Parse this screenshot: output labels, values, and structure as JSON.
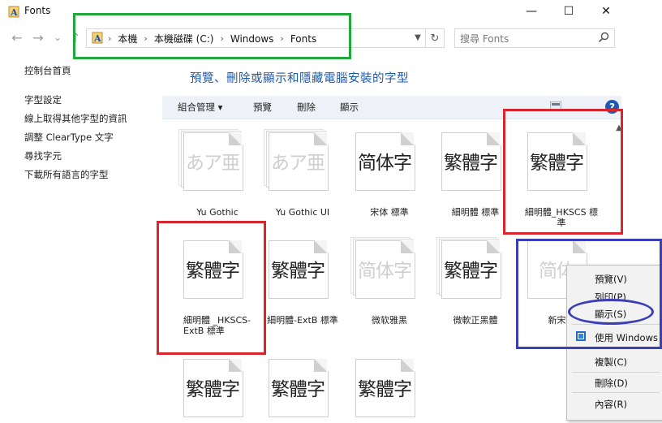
{
  "window": {
    "title": "Fonts"
  },
  "nav": {
    "back_symbol": "←",
    "forward_symbol": "→",
    "history_symbol": "⌄",
    "up_symbol": "↑",
    "breadcrumbs": [
      "本機",
      "本機磁碟 (C:)",
      "Windows",
      "Fonts"
    ],
    "crumb_separator": "›",
    "search_placeholder": "搜尋 Fonts"
  },
  "left_pane": {
    "links": [
      "控制台首頁",
      "字型設定",
      "線上取得其他字型的資訊",
      "調整 ClearType 文字",
      "尋找字元",
      "下載所有語言的字型"
    ]
  },
  "content": {
    "title": "預覽、刪除或顯示和隱藏電腦安裝的字型",
    "toolbar": {
      "organize": "組合管理 ▾",
      "preview": "預覽",
      "delete": "刪除",
      "show": "顯示"
    }
  },
  "fonts": [
    {
      "name": "Yu Gothic",
      "sample": "あア亜",
      "faint": true,
      "stack": true
    },
    {
      "name": "Yu Gothic UI",
      "sample": "あア亜",
      "faint": true,
      "stack": true
    },
    {
      "name": "宋体 標準",
      "sample": "简体字",
      "faint": false,
      "stack": false
    },
    {
      "name": "細明體 標準",
      "sample": "繁體字",
      "faint": false,
      "stack": false
    },
    {
      "name": "細明體_HKSCS 標準",
      "sample": "繁體字",
      "faint": false,
      "stack": false
    },
    {
      "name": "細明體 _HKSCS-ExtB 標準",
      "sample": "繁體字",
      "faint": false,
      "stack": false
    },
    {
      "name": "細明體-ExtB 標準",
      "sample": "繁體字",
      "faint": false,
      "stack": false
    },
    {
      "name": "微软雅黑",
      "sample": "简体字",
      "faint": true,
      "stack": true
    },
    {
      "name": "微軟正黑體",
      "sample": "繁體字",
      "faint": false,
      "stack": true
    },
    {
      "name": "新宋体",
      "sample": "简体",
      "faint": true,
      "stack": false
    },
    {
      "name": "",
      "sample": "繁體字",
      "faint": false,
      "stack": false
    },
    {
      "name": "",
      "sample": "繁體字",
      "faint": false,
      "stack": false
    },
    {
      "name": "",
      "sample": "繁體字",
      "faint": false,
      "stack": false
    }
  ],
  "context_menu": {
    "items": [
      "預覽(V)",
      "列印(P)",
      "顯示(S)",
      "使用 Windows",
      "複製(C)",
      "刪除(D)",
      "內容(R)"
    ]
  },
  "colors": {
    "annotation_green": "#22a83a",
    "annotation_red": "#d7262e",
    "annotation_blue": "#3b3fb6",
    "title_blue": "#1e5aa8"
  }
}
